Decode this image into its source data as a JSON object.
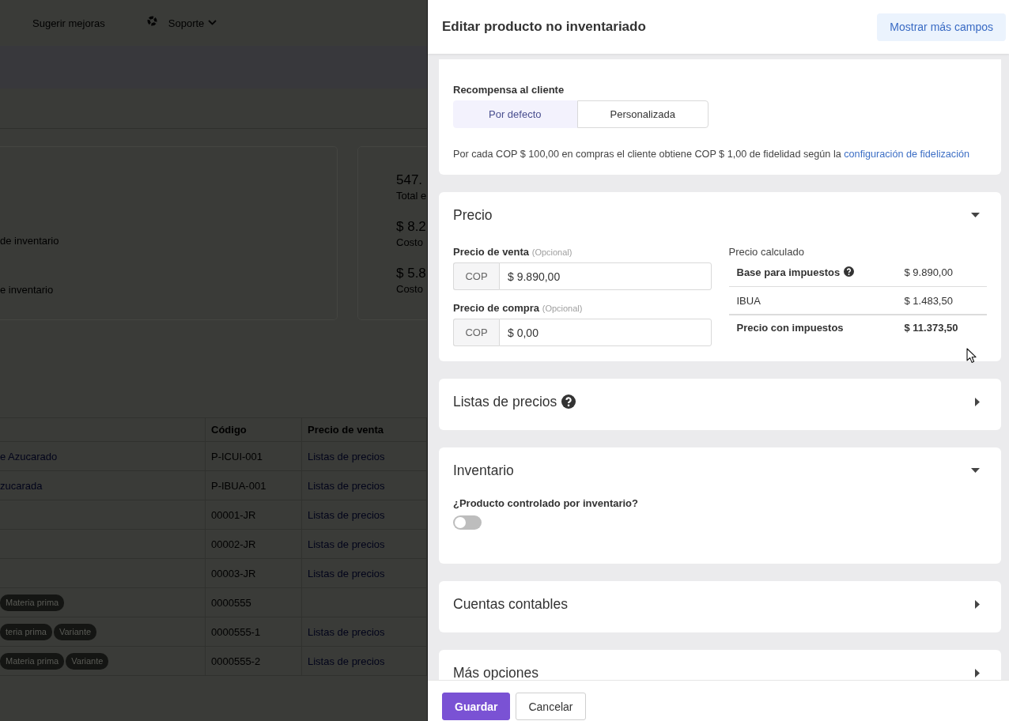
{
  "background_page": {
    "nav": {
      "items": [
        {
          "label": "Sugerir mejoras",
          "kind": "link"
        },
        {
          "label": "Soporte",
          "kind": "menu"
        }
      ]
    },
    "summary_cards": [
      {
        "stats": [
          {
            "label": "de inventario"
          },
          {
            "label": "e inventario"
          }
        ]
      },
      {
        "stats": [
          {
            "value": "547.",
            "label": "Total e"
          },
          {
            "value": "$ 8.2",
            "label": "Costo"
          },
          {
            "value": "$ 5.8",
            "label": "Costo"
          }
        ]
      }
    ],
    "table": {
      "columns": [
        "Código",
        "Precio de venta"
      ],
      "rows": [
        {
          "column_1": "e Azucarado",
          "codigo": "P-ICUI-001",
          "precio_de_venta": "Listas de precios"
        },
        {
          "column_1": "zucarada",
          "codigo": "P-IBUA-001",
          "precio_de_venta": "Listas de precios"
        },
        {
          "codigo": "00001-JR",
          "precio_de_venta": "Listas de precios"
        },
        {
          "codigo": "00002-JR",
          "precio_de_venta": "Listas de precios"
        },
        {
          "codigo": "00003-JR",
          "precio_de_venta": "Listas de precios"
        },
        {
          "tags": [
            "Materia prima"
          ],
          "codigo": "0000555"
        },
        {
          "tags": [
            "teria prima",
            "Variante"
          ],
          "codigo": "0000555-1",
          "precio_de_venta": "Listas de precios"
        },
        {
          "tags": [
            "Materia prima",
            "Variante"
          ],
          "codigo": "0000555-2",
          "precio_de_venta": "Listas de precios"
        }
      ]
    }
  },
  "drawer": {
    "title": "Editar producto no inventariado",
    "header_button": "Mostrar más campos",
    "sections": [
      {
        "kind": "reward",
        "label": "Recompensa al cliente",
        "options": [
          {
            "label": "Por defecto",
            "selected": true
          },
          {
            "label": "Personalizada",
            "selected": false
          }
        ],
        "note": "Por cada COP $ 100,00 en compras el cliente obtiene COP $ 1,00 de fidelidad según la",
        "note_link": "configuración de fidelización"
      },
      {
        "kind": "price",
        "title": "Precio",
        "expanded": true,
        "fields": [
          {
            "label": "Precio de venta",
            "hint": "(Opcional)",
            "currency": "COP",
            "value": "$ 9.890,00"
          },
          {
            "label": "Precio de compra",
            "hint": "(Opcional)",
            "currency": "COP",
            "value": "$ 0,00"
          }
        ],
        "calculated": {
          "title": "Precio calculado",
          "rows": [
            {
              "kind": "base",
              "label": "Base para impuestos",
              "value": "$ 9.890,00"
            },
            {
              "kind": "tax",
              "label": "IBUA",
              "value": "$ 1.483,50"
            },
            {
              "kind": "total",
              "label": "Precio con impuestos",
              "value": "$ 11.373,50"
            }
          ]
        }
      },
      {
        "kind": "plain",
        "title": "Listas de precios",
        "help": true,
        "expanded": false
      },
      {
        "kind": "inventory",
        "title": "Inventario",
        "expanded": true,
        "toggle_label": "¿Producto controlado por inventario?",
        "on": false
      },
      {
        "kind": "plain",
        "title": "Cuentas contables",
        "expanded": false
      },
      {
        "kind": "plain",
        "title": "Más opciones",
        "expanded": false
      }
    ],
    "footer_buttons": [
      {
        "label": "Guardar",
        "kind": "primary"
      },
      {
        "label": "Cancelar",
        "kind": "secondary"
      }
    ]
  }
}
